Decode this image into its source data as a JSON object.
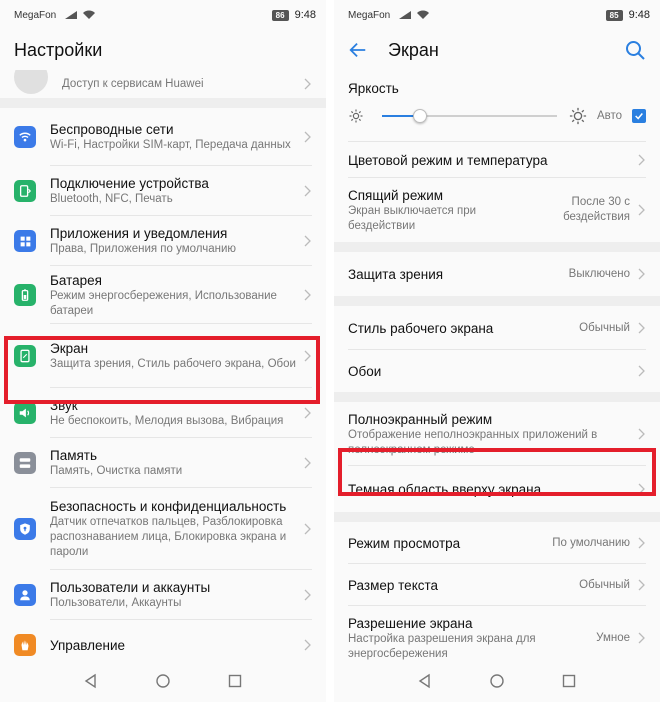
{
  "colors": {
    "accent": "#2a7fe0",
    "highlight": "#e41e2b"
  },
  "left": {
    "status": {
      "carrier": "MegaFon",
      "battery": "86",
      "time": "9:48"
    },
    "header": {
      "title": "Настройки"
    },
    "account": {
      "subtitle": "Доступ к сервисам Huawei"
    },
    "items": [
      {
        "title": "Беспроводные сети",
        "subtitle": "Wi-Fi, Настройки SIM-карт, Передача данных",
        "icon": "wifi-icon",
        "color": "#3b7ae8"
      },
      {
        "title": "Подключение устройства",
        "subtitle": "Bluetooth, NFC, Печать",
        "icon": "device-connection-icon",
        "color": "#27b26a"
      },
      {
        "title": "Приложения и уведомления",
        "subtitle": "Права, Приложения по умолчанию",
        "icon": "apps-icon",
        "color": "#3b7ae8"
      },
      {
        "title": "Батарея",
        "subtitle": "Режим энергосбережения, Использование батареи",
        "icon": "battery-icon",
        "color": "#27b26a"
      },
      {
        "title": "Экран",
        "subtitle": "Защита зрения, Стиль рабочего экрана, Обои",
        "icon": "display-icon",
        "color": "#27b26a"
      },
      {
        "title": "Звук",
        "subtitle": "Не беспокоить, Мелодия вызова, Вибрация",
        "icon": "sound-icon",
        "color": "#27b26a"
      },
      {
        "title": "Память",
        "subtitle": "Память, Очистка памяти",
        "icon": "storage-icon",
        "color": "#8a8f99"
      },
      {
        "title": "Безопасность и конфиденциальность",
        "subtitle": "Датчик отпечатков пальцев, Разблокировка распознаванием лица, Блокировка экрана и пароли",
        "icon": "security-icon",
        "color": "#3b7ae8"
      },
      {
        "title": "Пользователи и аккаунты",
        "subtitle": "Пользователи, Аккаунты",
        "icon": "users-icon",
        "color": "#3b7ae8"
      },
      {
        "title": "Управление",
        "subtitle": "",
        "icon": "hand-icon",
        "color": "#f08a24"
      }
    ]
  },
  "right": {
    "status": {
      "carrier": "MegaFon",
      "battery": "85",
      "time": "9:48"
    },
    "header": {
      "title": "Экран"
    },
    "brightness": {
      "title": "Яркость",
      "auto_label": "Авто",
      "level": 0.22,
      "auto_checked": true
    },
    "items": [
      {
        "title": "Цветовой режим и температура",
        "subtitle": "",
        "value": ""
      },
      {
        "title": "Спящий режим",
        "subtitle": "Экран выключается при бездействии",
        "value": "После 30 с бездействия"
      },
      {
        "title": "Защита зрения",
        "subtitle": "",
        "value": "Выключено"
      },
      {
        "title": "Стиль рабочего экрана",
        "subtitle": "",
        "value": "Обычный"
      },
      {
        "title": "Обои",
        "subtitle": "",
        "value": ""
      },
      {
        "title": "Полноэкранный режим",
        "subtitle": "Отображение неполноэкранных приложений в полноэкранном режиме",
        "value": ""
      },
      {
        "title": "Темная область вверху экрана",
        "subtitle": "",
        "value": ""
      },
      {
        "title": "Режим просмотра",
        "subtitle": "",
        "value": "По умолчанию"
      },
      {
        "title": "Размер текста",
        "subtitle": "",
        "value": "Обычный"
      },
      {
        "title": "Разрешение экрана",
        "subtitle": "Настройка разрешения экрана для энергосбережения",
        "value": "Умное"
      }
    ]
  }
}
